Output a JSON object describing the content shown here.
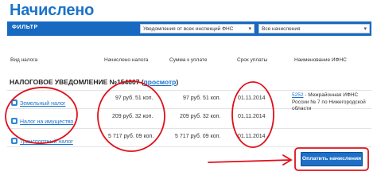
{
  "page": {
    "title": "Начислено"
  },
  "filter": {
    "label": "ФИЛЬТР",
    "inspection_select": "Уведомления от всех инспекций ФНС",
    "status_select": "Все начисления"
  },
  "table": {
    "columns": [
      "Вид налога",
      "Начислено налога",
      "Сумма к уплате",
      "Срок уплаты",
      "Наименование ИФНС"
    ],
    "notice": {
      "label": "НАЛОГОВОЕ УВЕДОМЛЕНИЕ №154607",
      "view_link": "просмотр"
    },
    "rows": [
      {
        "tax": "Земельный налог",
        "accrued": "97 руб. 51 коп.",
        "due": "97 руб. 51 коп.",
        "deadline": "01.11.2014"
      },
      {
        "tax": "Налог на имущество",
        "accrued": "209 руб. 32 коп.",
        "due": "209 руб. 32 коп.",
        "deadline": "01.11.2014"
      },
      {
        "tax": "Транспортный налог",
        "accrued": "5 717 руб. 09 коп.",
        "due": "5 717 руб. 09 коп.",
        "deadline": "01.11.2014"
      }
    ],
    "ifns": {
      "code": "5252",
      "name": "Межрайонная ИФНС России № 7 по Нижегородской области"
    }
  },
  "actions": {
    "pay_button": "Оплатить начисления"
  },
  "annotations": {
    "color": "#e0101a"
  }
}
